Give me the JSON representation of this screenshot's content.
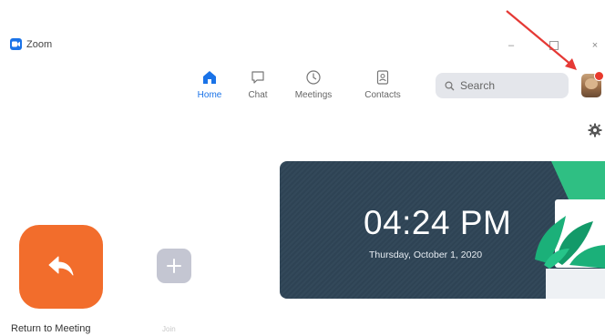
{
  "app": {
    "title": "Zoom"
  },
  "window_controls": {
    "minimize": "–",
    "close": "×"
  },
  "nav": {
    "items": [
      {
        "label": "Home",
        "icon": "home-icon",
        "active": true
      },
      {
        "label": "Chat",
        "icon": "chat-icon",
        "active": false
      },
      {
        "label": "Meetings",
        "icon": "clock-icon",
        "active": false
      },
      {
        "label": "Contacts",
        "icon": "contacts-icon",
        "active": false
      }
    ]
  },
  "search": {
    "placeholder": "Search",
    "icon": "search-icon"
  },
  "profile": {
    "icon": "avatar",
    "has_notification": true
  },
  "settings": {
    "icon": "gear-icon"
  },
  "clock": {
    "time": "04:24 PM",
    "date": "Thursday, October 1, 2020"
  },
  "actions": {
    "return_to_meeting": {
      "label": "Return to Meeting",
      "icon": "reply-arrow-icon",
      "color": "#f26d2c"
    },
    "join": {
      "label": "Join",
      "icon": "plus-icon",
      "color": "#c4c6d2"
    }
  },
  "annotation": {
    "color": "#e53935",
    "icon": "arrow-icon"
  },
  "colors": {
    "accent": "#1a73e8",
    "card_bg": "#2f4557",
    "notification": "#e8392c"
  }
}
